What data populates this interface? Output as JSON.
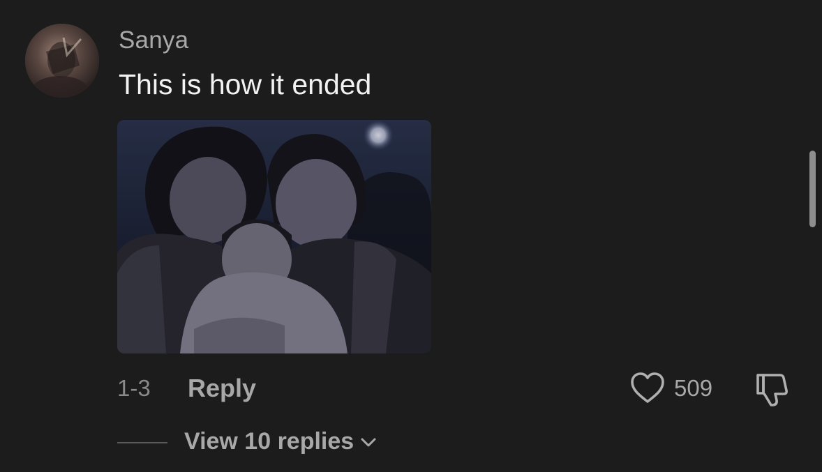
{
  "comment": {
    "username": "Sanya",
    "text": "This is how it ended",
    "date": "1-3",
    "reply_label": "Reply",
    "like_count": "509",
    "view_replies_label": "View 10 replies"
  },
  "icons": {
    "like": "heart-outline-icon",
    "dislike": "thumbs-down-icon",
    "expand": "chevron-down-icon"
  },
  "colors": {
    "background": "#1c1c1c",
    "username": "#a8a8a8",
    "text": "#f2f2f2",
    "muted": "#8a8a8a"
  }
}
